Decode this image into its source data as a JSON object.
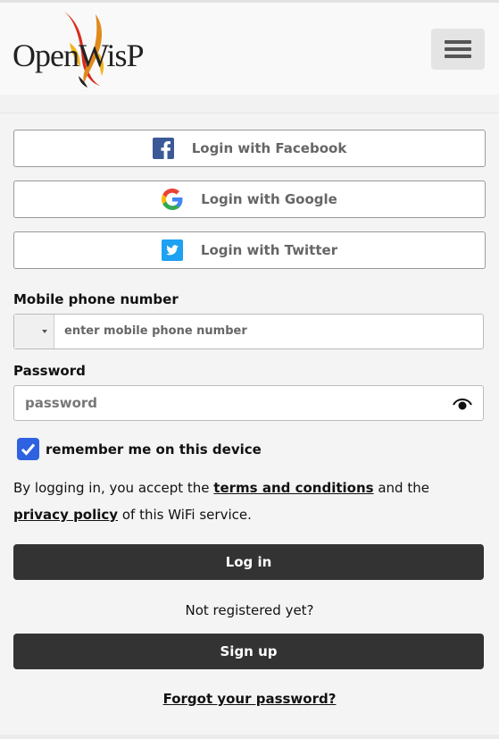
{
  "header": {
    "logo_text": "OpenWisP",
    "menu_icon": "hamburger-menu-icon"
  },
  "social": [
    {
      "label": "Login with Facebook",
      "icon": "facebook-icon",
      "color": "#3b5998"
    },
    {
      "label": "Login with Google",
      "icon": "google-icon",
      "color": "#4285f4"
    },
    {
      "label": "Login with Twitter",
      "icon": "twitter-icon",
      "color": "#1da1f2"
    }
  ],
  "phone": {
    "label": "Mobile phone number",
    "placeholder": "enter mobile phone number"
  },
  "password": {
    "label": "Password",
    "placeholder": "password",
    "toggle_icon": "eye-icon"
  },
  "remember": {
    "label": "remember me on this device",
    "checked": true,
    "color": "#2e62e0"
  },
  "terms": {
    "prefix": "By logging in, you accept the ",
    "terms_link": "terms and conditions",
    "middle": " and the",
    "privacy_link": "privacy policy",
    "suffix": " of this WiFi service."
  },
  "login_button": "Log in",
  "not_registered": "Not registered yet?",
  "signup_button": "Sign up",
  "forgot_link": "Forgot your password?"
}
